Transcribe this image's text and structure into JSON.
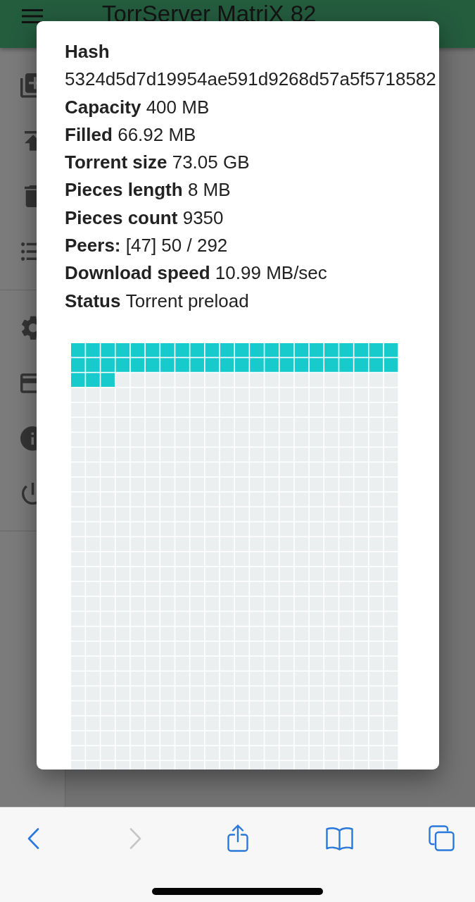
{
  "app_bar": {
    "title": "TorrServer MatriX 82"
  },
  "dialog": {
    "hash": {
      "label": "Hash",
      "value": "5324d5d7d19954ae591d9268d57a5f5718582"
    },
    "stats": [
      {
        "label": "Capacity",
        "value": "400 MB"
      },
      {
        "label": "Filled",
        "value": "66.92 MB"
      },
      {
        "label": "Torrent size",
        "value": "73.05 GB"
      },
      {
        "label": "Pieces length",
        "value": "8 MB"
      },
      {
        "label": "Pieces count",
        "value": "9350"
      },
      {
        "label": "Peers:",
        "value": "[47] 50 / 292"
      },
      {
        "label": "Download speed",
        "value": "10.99 MB/sec"
      },
      {
        "label": "Status",
        "value": "Torrent preload"
      }
    ],
    "piece_map": {
      "rows": [
        [
          true,
          true,
          true,
          true,
          true,
          true,
          true,
          true,
          true,
          true,
          true,
          true,
          true,
          true,
          true,
          true,
          true,
          true,
          true,
          true,
          true,
          true
        ],
        [
          true,
          true,
          true,
          true,
          true,
          true,
          true,
          true,
          true,
          true,
          true,
          true,
          true,
          true,
          true,
          true,
          true,
          true,
          true,
          true,
          true,
          true
        ],
        [
          true,
          true,
          true,
          false,
          false,
          false,
          false,
          false,
          false,
          false,
          false,
          false,
          false,
          false,
          false,
          false,
          false,
          false,
          false,
          false,
          false,
          false
        ],
        [
          false,
          false,
          false,
          false,
          false,
          false,
          false,
          false,
          false,
          false,
          false,
          false,
          false,
          false,
          false,
          false,
          false,
          false,
          false,
          false,
          false,
          false
        ],
        [
          false,
          false,
          false,
          false,
          false,
          false,
          false,
          false,
          false,
          false,
          false,
          false,
          false,
          false,
          false,
          false,
          false,
          false,
          false,
          false,
          false,
          false
        ],
        [
          false,
          false,
          false,
          false,
          false,
          false,
          false,
          false,
          false,
          false,
          false,
          false,
          false,
          false,
          false,
          false,
          false,
          false,
          false,
          false,
          false,
          false
        ],
        [
          false,
          false,
          false,
          false,
          false,
          false,
          false,
          false,
          false,
          false,
          false,
          false,
          false,
          false,
          false,
          false,
          false,
          false,
          false,
          false,
          false,
          false
        ],
        [
          false,
          false,
          false,
          false,
          false,
          false,
          false,
          false,
          false,
          false,
          false,
          false,
          false,
          false,
          false,
          false,
          false,
          false,
          false,
          false,
          false,
          false
        ],
        [
          false,
          false,
          false,
          false,
          false,
          false,
          false,
          false,
          false,
          false,
          false,
          false,
          false,
          false,
          false,
          false,
          false,
          false,
          false,
          false,
          false,
          false
        ],
        [
          false,
          false,
          false,
          false,
          false,
          false,
          false,
          false,
          false,
          false,
          false,
          false,
          false,
          false,
          false,
          false,
          false,
          false,
          false,
          false,
          false,
          false
        ],
        [
          false,
          false,
          false,
          false,
          false,
          false,
          false,
          false,
          false,
          false,
          false,
          false,
          false,
          false,
          false,
          false,
          false,
          false,
          false,
          false,
          false,
          false
        ],
        [
          false,
          false,
          false,
          false,
          false,
          false,
          false,
          false,
          false,
          false,
          false,
          false,
          false,
          false,
          false,
          false,
          false,
          false,
          false,
          false,
          false,
          false
        ],
        [
          false,
          false,
          false,
          false,
          false,
          false,
          false,
          false,
          false,
          false,
          false,
          false,
          false,
          false,
          false,
          false,
          false,
          false,
          false,
          false,
          false,
          false
        ],
        [
          false,
          false,
          false,
          false,
          false,
          false,
          false,
          false,
          false,
          false,
          false,
          false,
          false,
          false,
          false,
          false,
          false,
          false,
          false,
          false,
          false,
          false
        ],
        [
          false,
          false,
          false,
          false,
          false,
          false,
          false,
          false,
          false,
          false,
          false,
          false,
          false,
          false,
          false,
          false,
          false,
          false,
          false,
          false,
          false,
          false
        ],
        [
          false,
          false,
          false,
          false,
          false,
          false,
          false,
          false,
          false,
          false,
          false,
          false,
          false,
          false,
          false,
          false,
          false,
          false,
          false,
          false,
          false,
          false
        ],
        [
          false,
          false,
          false,
          false,
          false,
          false,
          false,
          false,
          false,
          false,
          false,
          false,
          false,
          false,
          false,
          false,
          false,
          false,
          false,
          false,
          false,
          false
        ],
        [
          false,
          false,
          false,
          false,
          false,
          false,
          false,
          false,
          false,
          false,
          false,
          false,
          false,
          false,
          false,
          false,
          false,
          false,
          false,
          false,
          false,
          false
        ],
        [
          false,
          false,
          false,
          false,
          false,
          false,
          false,
          false,
          false,
          false,
          false,
          false,
          false,
          false,
          false,
          false,
          false,
          false,
          false,
          false,
          false,
          false
        ],
        [
          false,
          false,
          false,
          false,
          false,
          false,
          false,
          false,
          false,
          false,
          false,
          false,
          false,
          false,
          false,
          false,
          false,
          false,
          false,
          false,
          false,
          false
        ],
        [
          false,
          false,
          false,
          false,
          false,
          false,
          false,
          false,
          false,
          false,
          false,
          false,
          false,
          false,
          false,
          false,
          false,
          false,
          false,
          false,
          false,
          false
        ],
        [
          false,
          false,
          false,
          false,
          false,
          false,
          false,
          false,
          false,
          false,
          false,
          false,
          false,
          false,
          false,
          false,
          false,
          false,
          false,
          false,
          false,
          false
        ],
        [
          false,
          false,
          false,
          false,
          false,
          false,
          false,
          false,
          false,
          false,
          false,
          false,
          false,
          false,
          false,
          false,
          false,
          false,
          false,
          false,
          false,
          false
        ],
        [
          false,
          false,
          false,
          false,
          false,
          false,
          false,
          false,
          false,
          false,
          false,
          false,
          false,
          false,
          false,
          false,
          false,
          false,
          false,
          false,
          false,
          false
        ],
        [
          false,
          false,
          false,
          false,
          false,
          false,
          false,
          false,
          false,
          false,
          false,
          false,
          false,
          false,
          false,
          false,
          false,
          false,
          false,
          false,
          false,
          false
        ],
        [
          false,
          false,
          false,
          false,
          false,
          false,
          false,
          false,
          false,
          false,
          false,
          false,
          false,
          false,
          false,
          false,
          false,
          false,
          false,
          false,
          false,
          false
        ],
        [
          false,
          false,
          false,
          false,
          false,
          false,
          false,
          false,
          false,
          false,
          false,
          false,
          false,
          false,
          false,
          false,
          false,
          false,
          false,
          false,
          false,
          false
        ],
        [
          false,
          false,
          false,
          false,
          false,
          false,
          false,
          false,
          false,
          false,
          false,
          false,
          false,
          false,
          false,
          false,
          false,
          false,
          false,
          false,
          false,
          false
        ],
        [
          false,
          false,
          false,
          false,
          false,
          false,
          false,
          false,
          false,
          false,
          false,
          false,
          false,
          false,
          false,
          false,
          false,
          false,
          false,
          false,
          false,
          false
        ]
      ]
    }
  },
  "browser_toolbar": {
    "back": {
      "disabled": false
    },
    "forward": {
      "disabled": true
    }
  }
}
